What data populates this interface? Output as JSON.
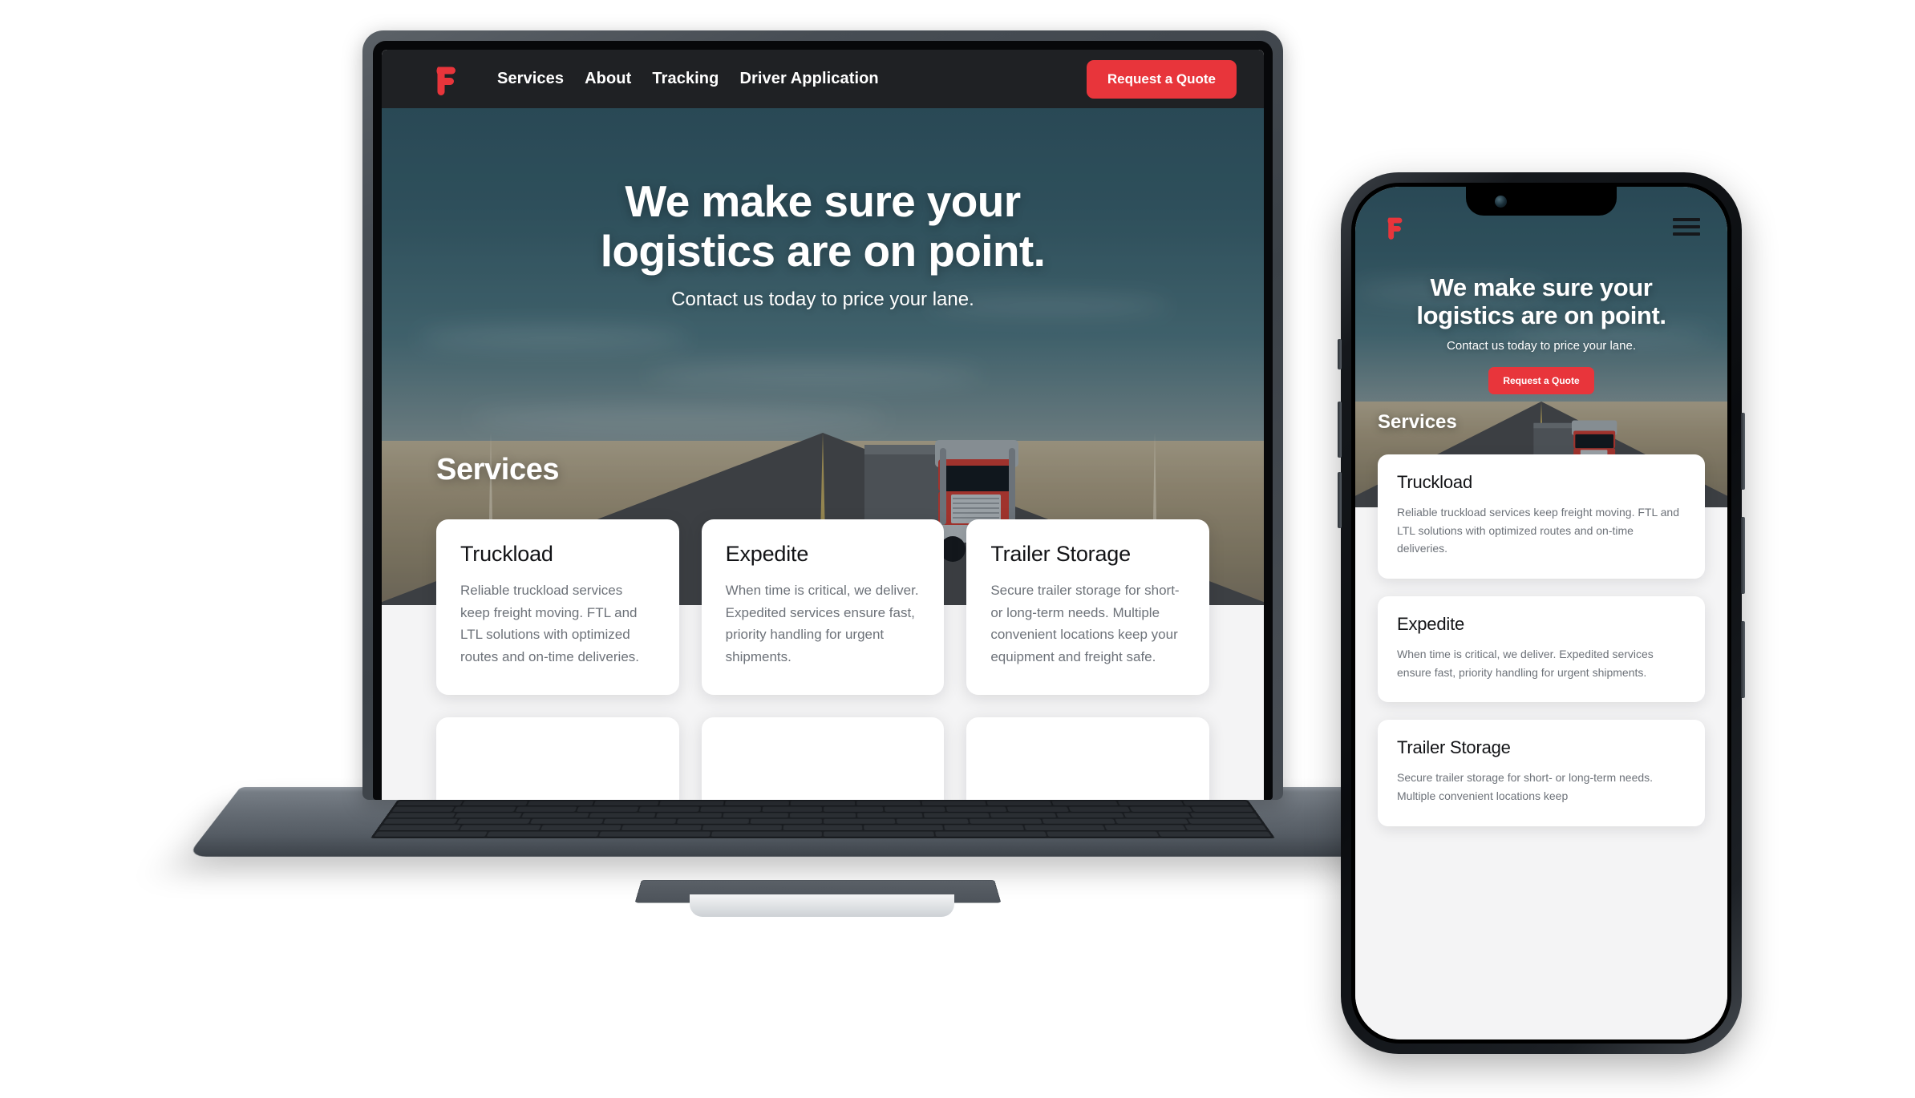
{
  "brand": {
    "logo_icon": "f-logo-icon",
    "accent_color": "#e8353b",
    "nav_background": "#1f2124"
  },
  "desktop": {
    "nav": {
      "links": [
        {
          "label": "Services"
        },
        {
          "label": "About"
        },
        {
          "label": "Tracking"
        },
        {
          "label": "Driver Application"
        }
      ],
      "cta_label": "Request a Quote"
    },
    "hero": {
      "heading_line1": "We make sure your",
      "heading_line2": "logistics are on point.",
      "subheading": "Contact us today to price your lane."
    },
    "services": {
      "title": "Services",
      "cards": [
        {
          "title": "Truckload",
          "body": "Reliable truckload services keep freight moving. FTL and LTL solutions with optimized routes and on-time deliveries."
        },
        {
          "title": "Expedite",
          "body": "When time is critical, we deliver. Expedited services ensure fast, priority handling for urgent shipments."
        },
        {
          "title": "Trailer Storage",
          "body": "Secure trailer storage for short- or long-term needs. Multiple convenient locations keep your equipment and freight safe."
        }
      ]
    }
  },
  "mobile": {
    "nav": {
      "menu_icon": "hamburger-menu-icon"
    },
    "hero": {
      "heading_line1": "We make sure your",
      "heading_line2": "logistics are on point.",
      "subheading": "Contact us today to price your lane.",
      "cta_label": "Request a Quote"
    },
    "services": {
      "title": "Services",
      "cards": [
        {
          "title": "Truckload",
          "body": "Reliable truckload services keep freight moving. FTL and LTL solutions with optimized routes and on-time deliveries."
        },
        {
          "title": "Expedite",
          "body": "When time is critical, we deliver. Expedited services ensure fast, priority handling for urgent shipments."
        },
        {
          "title": "Trailer Storage",
          "body": "Secure trailer storage for short- or long-term needs. Multiple convenient locations keep"
        }
      ]
    }
  }
}
